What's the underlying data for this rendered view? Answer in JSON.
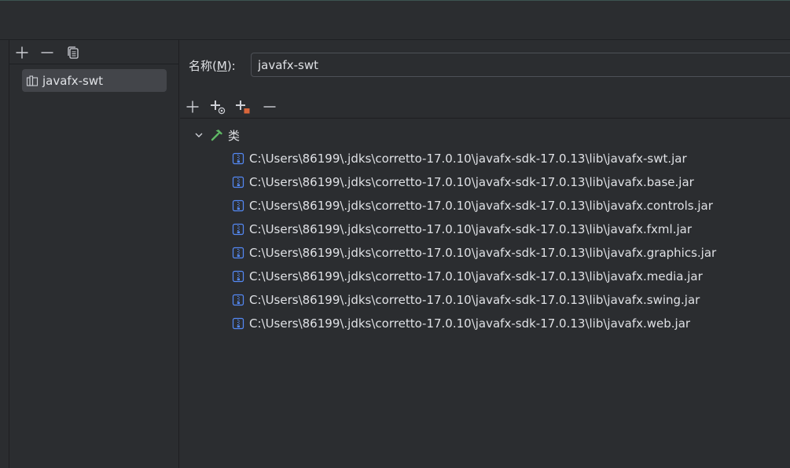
{
  "left_toolbar": {
    "add_icon": "plus-icon",
    "remove_icon": "minus-icon",
    "copy_icon": "copy-icon"
  },
  "libraries": [
    {
      "label": "javafx-swt",
      "icon": "library-icon"
    }
  ],
  "name_field": {
    "label_prefix": "名称(",
    "mnemonic": "M",
    "label_suffix": "):",
    "value": "javafx-swt"
  },
  "right_toolbar": {
    "icons": [
      "plus-icon",
      "add-from-maven-icon",
      "add-artifact-icon",
      "minus-icon"
    ]
  },
  "tree": {
    "root_label": "类",
    "items": [
      "C:\\Users\\86199\\.jdks\\corretto-17.0.10\\javafx-sdk-17.0.13\\lib\\javafx-swt.jar",
      "C:\\Users\\86199\\.jdks\\corretto-17.0.10\\javafx-sdk-17.0.13\\lib\\javafx.base.jar",
      "C:\\Users\\86199\\.jdks\\corretto-17.0.10\\javafx-sdk-17.0.13\\lib\\javafx.controls.jar",
      "C:\\Users\\86199\\.jdks\\corretto-17.0.10\\javafx-sdk-17.0.13\\lib\\javafx.fxml.jar",
      "C:\\Users\\86199\\.jdks\\corretto-17.0.10\\javafx-sdk-17.0.13\\lib\\javafx.graphics.jar",
      "C:\\Users\\86199\\.jdks\\corretto-17.0.10\\javafx-sdk-17.0.13\\lib\\javafx.media.jar",
      "C:\\Users\\86199\\.jdks\\corretto-17.0.10\\javafx-sdk-17.0.13\\lib\\javafx.swing.jar",
      "C:\\Users\\86199\\.jdks\\corretto-17.0.10\\javafx-sdk-17.0.13\\lib\\javafx.web.jar"
    ]
  },
  "colors": {
    "background": "#2b2d30",
    "selection": "#43454a",
    "text": "#dfe1e5",
    "jar_icon": "#548af7",
    "hammer_icon": "#5fb865"
  }
}
